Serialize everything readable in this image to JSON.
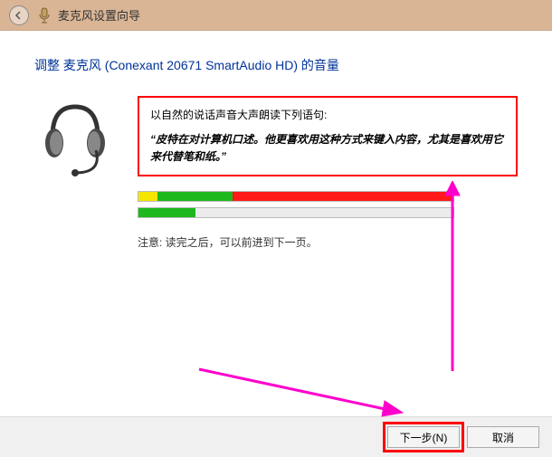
{
  "titlebar": {
    "title": "麦克风设置向导"
  },
  "heading": "调整 麦克风 (Conexant 20671 SmartAudio HD) 的音量",
  "instruction": {
    "title": "以自然的说话声音大声朗读下列语句:",
    "quote": "“皮特在对计算机口述。他更喜欢用这种方式来键入内容，尤其是喜欢用它来代替笔和纸。”"
  },
  "meters": {
    "bar1": {
      "yellow": 6,
      "green": 24,
      "red": 70,
      "empty": 0
    },
    "bar2": {
      "yellow": 0,
      "green": 18,
      "red": 0,
      "empty": 82
    }
  },
  "note": "注意: 读完之后，可以前进到下一页。",
  "footer": {
    "next": "下一步(N)",
    "cancel": "取消"
  },
  "icons": {
    "back": "back-arrow-icon",
    "mic": "microphone-icon",
    "headset": "headset-icon"
  },
  "colors": {
    "accent": "#003399",
    "highlight": "#ff0000",
    "annotation": "#ff00cc"
  }
}
